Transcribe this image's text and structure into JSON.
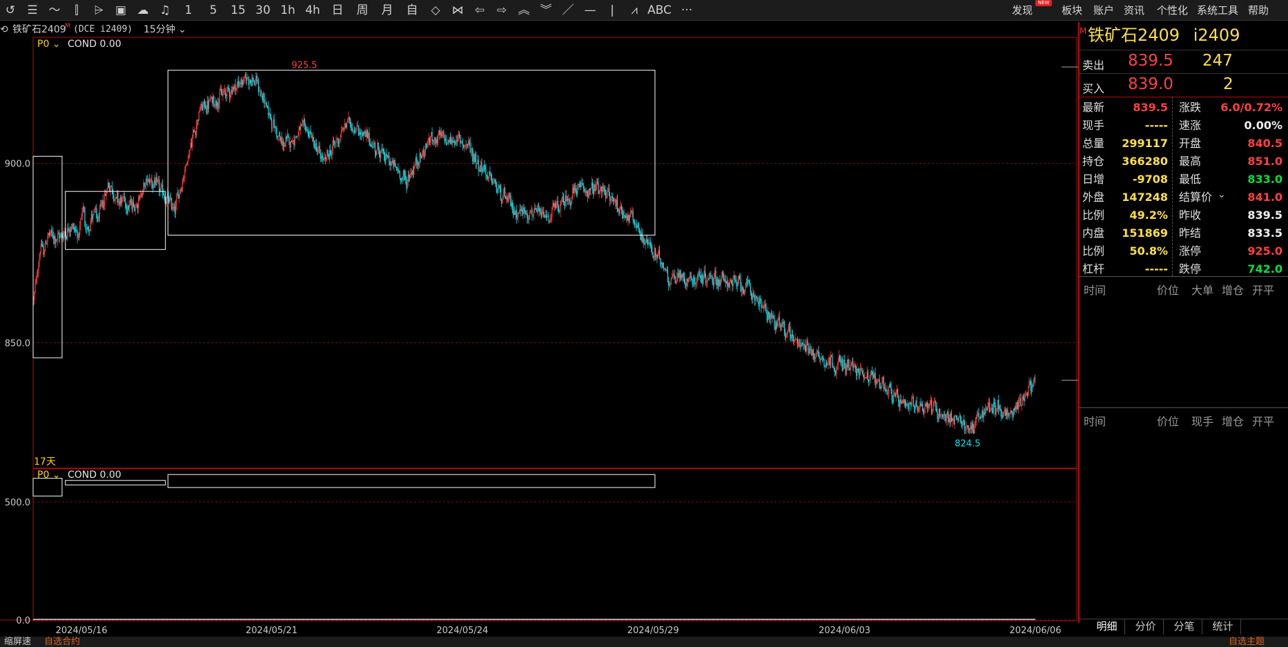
{
  "toolbar": {
    "left_items": [
      {
        "name": "back-icon",
        "glyph": "↺"
      },
      {
        "name": "list-icon",
        "glyph": "☰"
      },
      {
        "name": "line-chart-icon",
        "glyph": "〜"
      },
      {
        "name": "candle-icon",
        "glyph": "⫿"
      },
      {
        "name": "multi-candle-icon",
        "glyph": "⩥"
      },
      {
        "name": "panel-icon",
        "glyph": "▣"
      },
      {
        "name": "cloud-sync-icon",
        "glyph": "☁"
      },
      {
        "name": "bell-icon",
        "glyph": "♫"
      }
    ],
    "periods": [
      "1",
      "5",
      "15",
      "30",
      "1h",
      "4h",
      "日",
      "周",
      "月",
      "自"
    ],
    "draw_items": [
      {
        "name": "diamond-icon",
        "glyph": "◇"
      },
      {
        "name": "bowtie-icon",
        "glyph": "⋈"
      },
      {
        "name": "left-arrow-icon",
        "glyph": "⇦"
      },
      {
        "name": "right-arrow-icon",
        "glyph": "⇨"
      },
      {
        "name": "up-chevron-icon",
        "glyph": "︽"
      },
      {
        "name": "down-chevron-icon",
        "glyph": "︾"
      },
      {
        "name": "trend-line-icon",
        "glyph": "／"
      },
      {
        "name": "horizontal-line-icon",
        "glyph": "—"
      },
      {
        "name": "vertical-line-icon",
        "glyph": "|"
      },
      {
        "name": "wave-icon",
        "glyph": "⩘"
      },
      {
        "name": "text-tool-icon",
        "glyph": "ABC"
      },
      {
        "name": "more-icon",
        "glyph": "···"
      }
    ],
    "menu": [
      "发现",
      "板块",
      "账户",
      "资讯",
      "个性化",
      "系统工具",
      "帮助"
    ],
    "new_badge": "NEW"
  },
  "chart_header": {
    "symbol": "铁矿石2409",
    "marker": "M",
    "exchange": "(DCE i2409)",
    "period": "15分钟"
  },
  "main_panel": {
    "indicator": "P0",
    "cond": "COND 0.00",
    "days_label": "17天",
    "high_label": "925.5",
    "low_label": "824.5",
    "y_ticks": [
      "900.0",
      "850.0"
    ]
  },
  "sub_panel": {
    "indicator": "P0",
    "cond": "COND 0.00",
    "y_ticks": [
      "500.0",
      "0.0"
    ]
  },
  "x_axis": [
    "2024/05/16",
    "2024/05/21",
    "2024/05/24",
    "2024/05/29",
    "2024/06/03",
    "2024/06/06"
  ],
  "chart_data": {
    "type": "candlestick",
    "ylim": [
      815,
      935
    ],
    "high": 925.5,
    "low": 824.5,
    "last": 839.5,
    "anchors": [
      [
        0,
        862
      ],
      [
        8,
        878
      ],
      [
        12,
        874
      ],
      [
        15,
        880
      ],
      [
        30,
        879
      ],
      [
        45,
        883
      ],
      [
        55,
        880
      ],
      [
        60,
        888
      ],
      [
        62,
        880
      ],
      [
        70,
        886
      ],
      [
        78,
        884
      ],
      [
        90,
        895
      ],
      [
        100,
        890
      ],
      [
        120,
        888
      ],
      [
        140,
        896
      ],
      [
        170,
        887
      ],
      [
        200,
        915
      ],
      [
        260,
        924
      ],
      [
        270,
        922
      ],
      [
        300,
        905
      ],
      [
        330,
        910
      ],
      [
        350,
        900
      ],
      [
        380,
        912
      ],
      [
        420,
        903
      ],
      [
        450,
        895
      ],
      [
        480,
        907
      ],
      [
        520,
        906
      ],
      [
        550,
        896
      ],
      [
        580,
        887
      ],
      [
        620,
        885
      ],
      [
        640,
        889
      ],
      [
        660,
        893
      ],
      [
        690,
        892
      ],
      [
        720,
        885
      ],
      [
        770,
        868
      ],
      [
        820,
        868
      ],
      [
        860,
        866
      ],
      [
        900,
        855
      ],
      [
        950,
        846
      ],
      [
        990,
        843
      ],
      [
        1030,
        838
      ],
      [
        1050,
        832
      ],
      [
        1080,
        833
      ],
      [
        1100,
        830
      ],
      [
        1130,
        826
      ],
      [
        1160,
        833
      ],
      [
        1180,
        829
      ],
      [
        1212,
        841
      ]
    ],
    "n_bars": 1212,
    "sub_ylim": [
      0,
      640
    ],
    "boxes": [
      {
        "from": 0,
        "to": 35,
        "low": 845.8,
        "high": 902
      },
      {
        "from": 39,
        "to": 160,
        "low": 876,
        "high": 892.2
      },
      {
        "from": 163,
        "to": 752,
        "low": 880,
        "high": 926
      },
      {
        "from": 752,
        "to": 752,
        "low": 0,
        "high": 0
      }
    ],
    "sub_boxes": [
      {
        "from": 0,
        "to": 35,
        "low": 525,
        "high": 600
      },
      {
        "from": 39,
        "to": 160,
        "low": 572,
        "high": 591
      },
      {
        "from": 163,
        "to": 752,
        "low": 561,
        "high": 616
      }
    ],
    "up_color": "#ff3b3b",
    "down_color": "#00e5ee",
    "grid_color": "#7a1010"
  },
  "quote": {
    "title_symbol": "铁矿石2409",
    "title_code": "i2409",
    "marker": "M",
    "ask_label": "卖出",
    "ask_price": "839.5",
    "ask_vol": "247",
    "bid_label": "买入",
    "bid_price": "839.0",
    "bid_vol": "2",
    "rows": [
      {
        "l1": "最新",
        "v1": "839.5",
        "c1": "red",
        "l2": "涨跌",
        "v2": "6.0/0.72%",
        "c2": "red"
      },
      {
        "l1": "现手",
        "v1": "-----",
        "c1": "yel",
        "l2": "速涨",
        "v2": "0.00%",
        "c2": "white"
      },
      {
        "l1": "总量",
        "v1": "299117",
        "c1": "yel",
        "l2": "开盘",
        "v2": "840.5",
        "c2": "red"
      },
      {
        "l1": "持仓",
        "v1": "366280",
        "c1": "yel",
        "l2": "最高",
        "v2": "851.0",
        "c2": "red"
      },
      {
        "l1": "日增",
        "v1": "-9708",
        "c1": "yel",
        "l2": "最低",
        "v2": "833.0",
        "c2": "green"
      },
      {
        "l1": "外盘",
        "v1": "147248",
        "c1": "yel",
        "l2": "结算价",
        "v2": "841.0",
        "c2": "red"
      },
      {
        "l1": "比例",
        "v1": "49.2%",
        "c1": "yel",
        "l2": "昨收",
        "v2": "839.5",
        "c2": "white"
      },
      {
        "l1": "内盘",
        "v1": "151869",
        "c1": "yel",
        "l2": "昨结",
        "v2": "833.5",
        "c2": "white"
      },
      {
        "l1": "比例",
        "v1": "50.8%",
        "c1": "yel",
        "l2": "涨停",
        "v2": "925.0",
        "c2": "red"
      },
      {
        "l1": "杠杆",
        "v1": "-----",
        "c1": "yel",
        "l2": "跌停",
        "v2": "742.0",
        "c2": "green"
      }
    ],
    "trade_headers_1": [
      "时间",
      "价位",
      "大单",
      "增仓",
      "开平"
    ],
    "trade_headers_2": [
      "时间",
      "价位",
      "现手",
      "增仓",
      "开平"
    ],
    "tabs": [
      "明细",
      "分价",
      "分笔",
      "统计"
    ]
  },
  "statusbar": {
    "left": "缩屏速",
    "mid": "自选合约",
    "right": "自选主题"
  }
}
